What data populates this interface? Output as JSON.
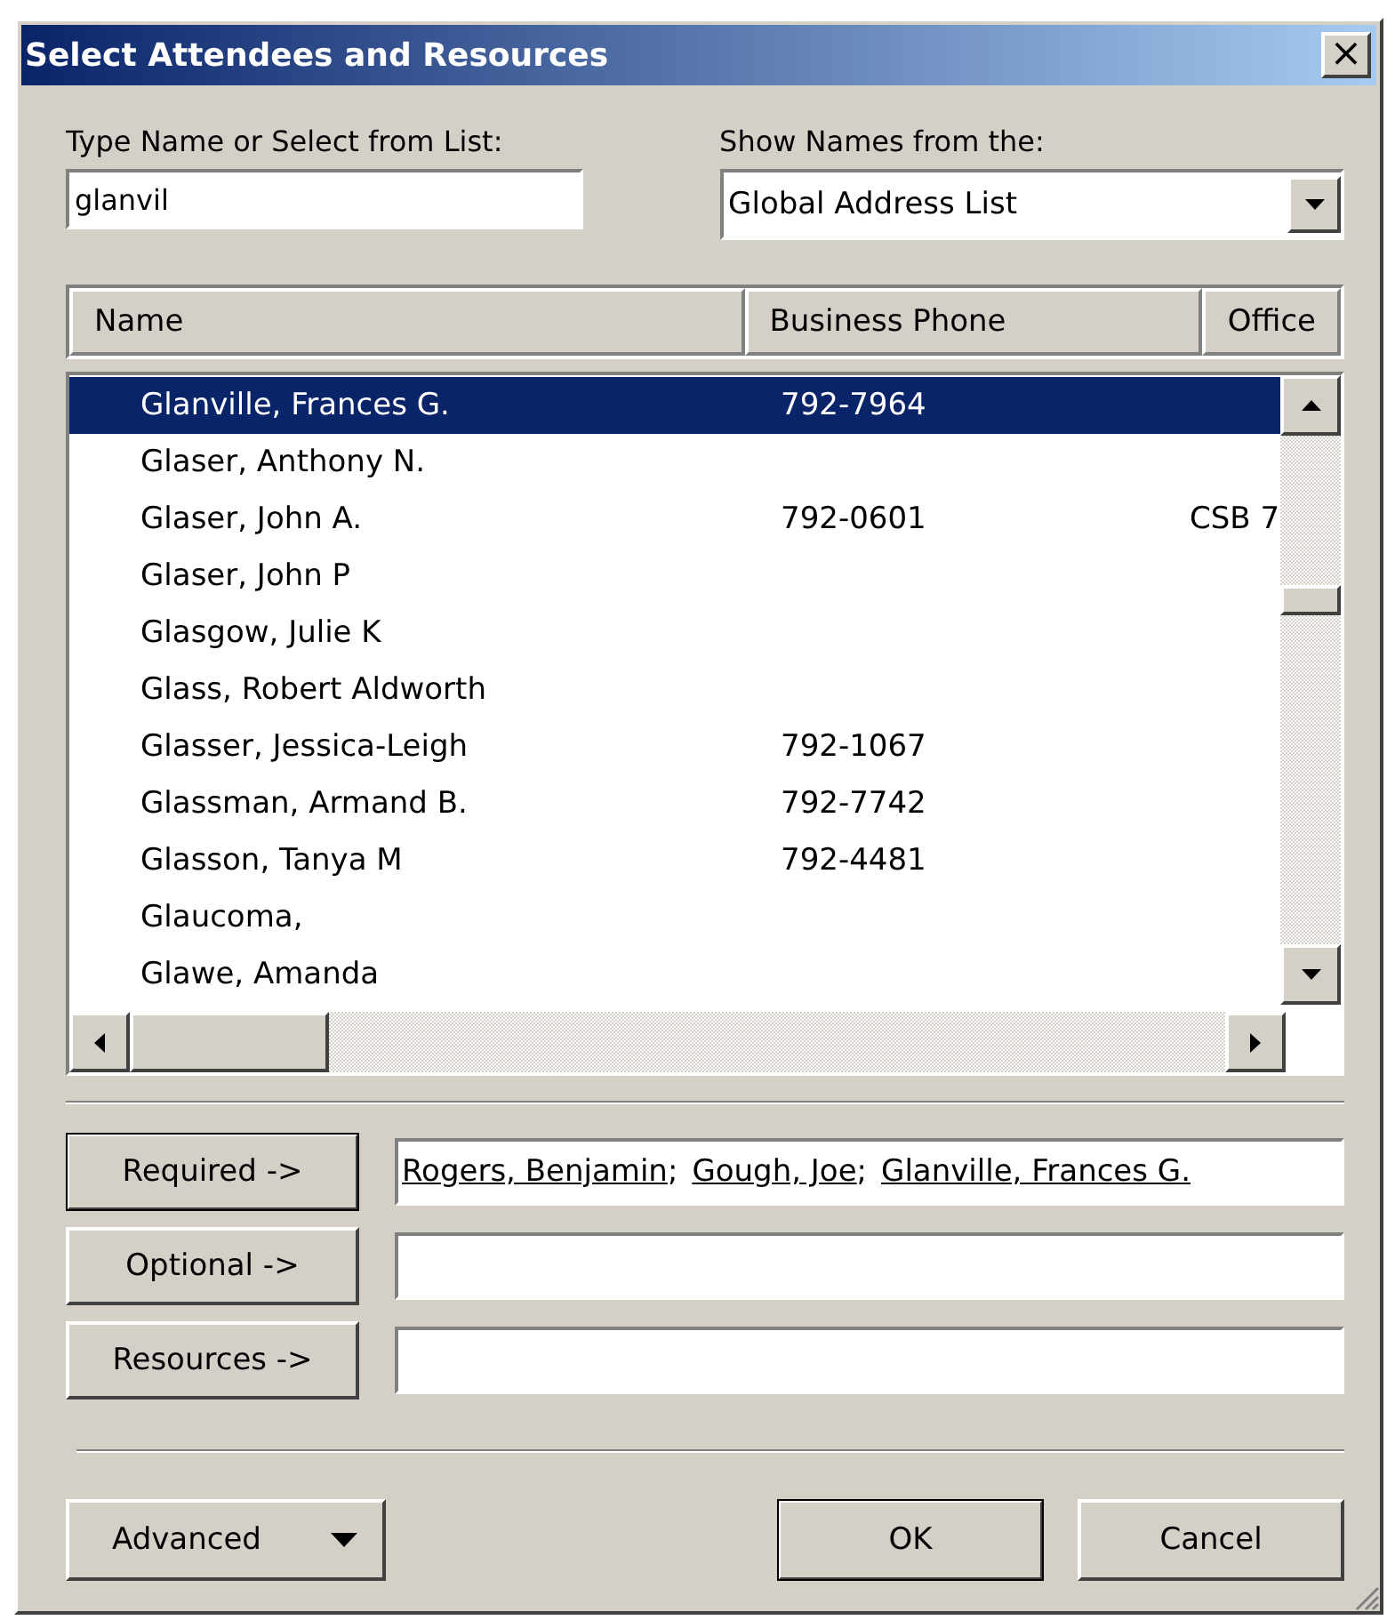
{
  "window": {
    "title": "Select Attendees and Resources",
    "close": "×"
  },
  "name_search": {
    "label": "Type Name or Select from List:",
    "value": "glanvil"
  },
  "address_book": {
    "label": "Show Names from the:",
    "value": "Global Address List"
  },
  "table": {
    "columns": [
      "Name",
      "Business Phone",
      "Office"
    ],
    "rows": [
      {
        "name": "Glanville, Frances G.",
        "phone": "792-7964",
        "office": "",
        "selected": true
      },
      {
        "name": "Glaser, Anthony N.",
        "phone": "",
        "office": "",
        "selected": false
      },
      {
        "name": "Glaser, John A.",
        "phone": "792-0601",
        "office": "CSB 7",
        "selected": false
      },
      {
        "name": "Glaser, John P",
        "phone": "",
        "office": "",
        "selected": false
      },
      {
        "name": "Glasgow, Julie K",
        "phone": "",
        "office": "",
        "selected": false
      },
      {
        "name": "Glass, Robert Aldworth",
        "phone": "",
        "office": "",
        "selected": false
      },
      {
        "name": "Glasser, Jessica-Leigh",
        "phone": "792-1067",
        "office": "",
        "selected": false
      },
      {
        "name": "Glassman, Armand B.",
        "phone": "792-7742",
        "office": "",
        "selected": false
      },
      {
        "name": "Glasson, Tanya M",
        "phone": "792-4481",
        "office": "",
        "selected": false
      },
      {
        "name": "Glaucoma,",
        "phone": "",
        "office": "",
        "selected": false
      },
      {
        "name": "Glawe, Amanda",
        "phone": "",
        "office": "",
        "selected": false
      }
    ]
  },
  "attendee_fields": [
    {
      "button": "Required ->",
      "default": true,
      "separator": ";",
      "recipients": [
        "Rogers, Benjamin",
        "Gough, Joe",
        "Glanville, Frances G."
      ]
    },
    {
      "button": "Optional ->",
      "default": false
    },
    {
      "button": "Resources ->",
      "default": false
    }
  ],
  "buttons": {
    "advanced": "Advanced",
    "ok": "OK",
    "cancel": "Cancel"
  }
}
